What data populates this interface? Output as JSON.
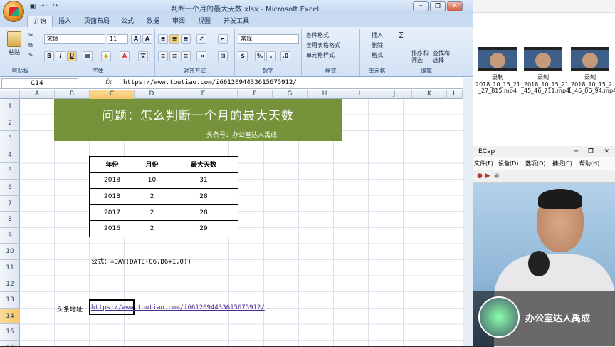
{
  "excel": {
    "window_title": "判断一个月的最大天数.xlsx - Microsoft Excel",
    "tabs": [
      "开始",
      "插入",
      "页面布局",
      "公式",
      "数据",
      "审阅",
      "视图",
      "开发工具"
    ],
    "ribbon": {
      "clipboard": {
        "label": "剪贴板",
        "paste": "粘贴"
      },
      "font": {
        "label": "字体",
        "name": "宋体",
        "size": "11",
        "bold": "B",
        "italic": "I",
        "underline": "U"
      },
      "alignment": {
        "label": "对齐方式"
      },
      "number": {
        "label": "数字",
        "format": "常规",
        "percent": "%",
        "comma": ","
      },
      "styles": {
        "label": "样式",
        "cond_format": "条件格式",
        "table_format": "套用表格格式",
        "cell_style": "单元格样式"
      },
      "cells": {
        "label": "单元格",
        "insert": "插入",
        "delete": "删除",
        "format": "格式"
      },
      "editing": {
        "label": "编辑",
        "sort": "排序和筛选",
        "find": "查找和选择",
        "sigma": "Σ"
      }
    },
    "name_box": "C14",
    "formula_bar": "https://www.toutiao.com/i6612094433615675912/",
    "fx": "fx",
    "columns": [
      "A",
      "B",
      "C",
      "D",
      "E",
      "F",
      "G",
      "H",
      "I",
      "J",
      "K",
      "L"
    ],
    "rows": [
      "1",
      "2",
      "3",
      "4",
      "5",
      "6",
      "7",
      "8",
      "9",
      "10",
      "11",
      "12",
      "13",
      "14",
      "15",
      "16"
    ],
    "banner_title": "问题：怎么判断一个月的最大天数",
    "banner_subtitle": "头条号：办公室达人禹成",
    "table": {
      "headers": [
        "年份",
        "月份",
        "最大天数"
      ],
      "rows": [
        [
          "2018",
          "10",
          "31"
        ],
        [
          "2018",
          "2",
          "28"
        ],
        [
          "2017",
          "2",
          "28"
        ],
        [
          "2016",
          "2",
          "29"
        ]
      ]
    },
    "formula_note": "公式：=DAY(DATE(C6,D6+1,0))",
    "link_label": "头条地址",
    "link_url": "https://www.toutiao.com/i6612094433615675912/",
    "colors": {
      "banner": "#76933c",
      "ribbon": "#dbe8f7"
    }
  },
  "explorer": {
    "files": [
      {
        "line1": "录制",
        "line2": "2018_10_15_21",
        "line3": "_27_815.mp4"
      },
      {
        "line1": "录制",
        "line2": "_2018_10_15_21",
        "line3": "_45_46_711.mp4"
      },
      {
        "line1": "录制",
        "line2": "_2018_10_15_2",
        "line3": "1_46_06_94.mp4"
      }
    ]
  },
  "ecap": {
    "title": "ECap",
    "menu": [
      "文件(F)",
      "设备(D)",
      "选项(O)",
      "捕捉(C)",
      "帮助(H)"
    ]
  },
  "watermark": {
    "text": "办公室达人禹成"
  }
}
